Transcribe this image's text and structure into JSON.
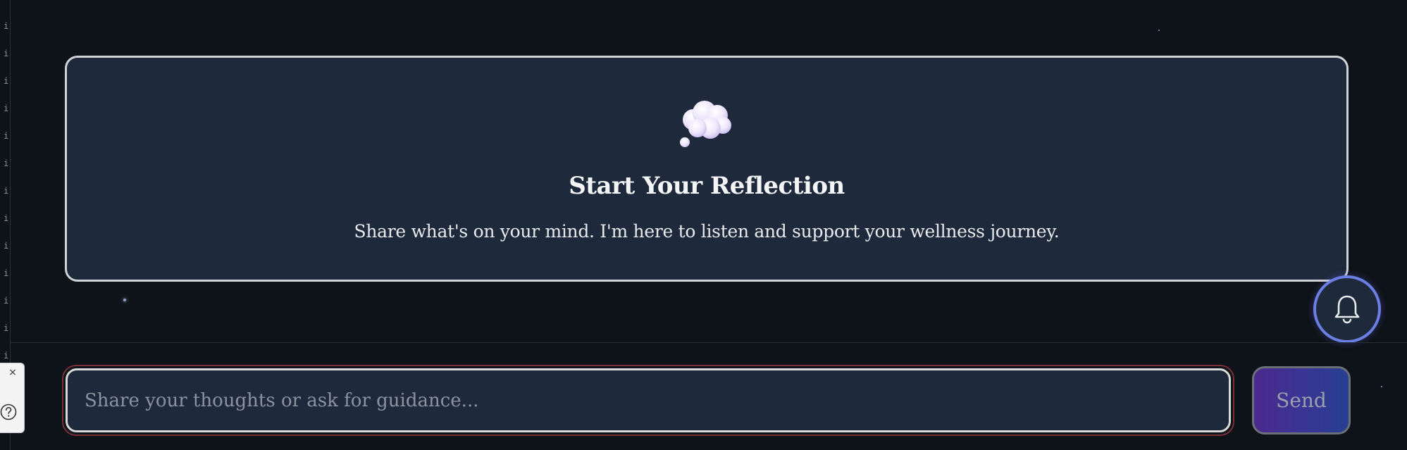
{
  "empty_state": {
    "title": "Start Your Reflection",
    "subtitle": "Share what's on your mind. I'm here to listen and support your wellness journey.",
    "icon": "thought-bubble-icon"
  },
  "composer": {
    "placeholder": "Share your thoughts or ask for guidance...",
    "value": "",
    "send_label": "Send"
  },
  "notifications": {
    "icon": "bell-icon"
  },
  "help_widget": {
    "close_glyph": "×",
    "icon": "question-circle-icon"
  },
  "colors": {
    "background": "#0e1319",
    "card": "#1e293b",
    "accent_ring": "#6b7fe3",
    "send_gradient_start": "#4a2a8c",
    "send_gradient_end": "#263f8f"
  }
}
